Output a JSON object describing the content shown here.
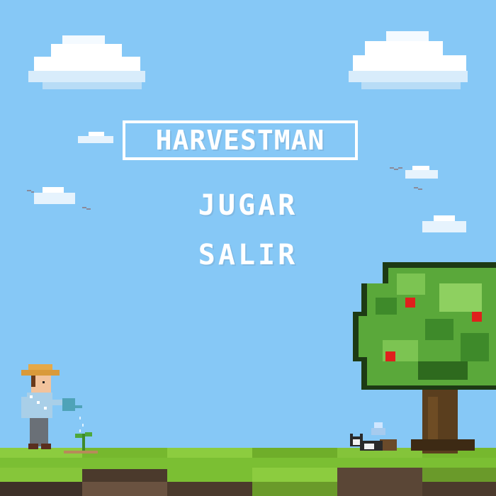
{
  "game": {
    "title": "HARVESTMAN",
    "menu": {
      "play_label": "JUGAR",
      "exit_label": "SALIR"
    }
  },
  "colors": {
    "sky": "#86c8f6",
    "text": "#ffffff",
    "grass_light": "#8cc63f",
    "grass_dark": "#6aa82a",
    "dirt": "#5a4636",
    "tree_leaves": "#5aa83a",
    "tree_trunk": "#5a3e1e",
    "apple": "#e0201c"
  },
  "icons": {
    "farmer": "farmer-icon",
    "tree": "apple-tree-icon",
    "cat": "cat-icon",
    "sprout": "sprout-icon",
    "cloud": "cloud-icon",
    "bird": "bird-icon",
    "crystal": "crystal-icon"
  }
}
